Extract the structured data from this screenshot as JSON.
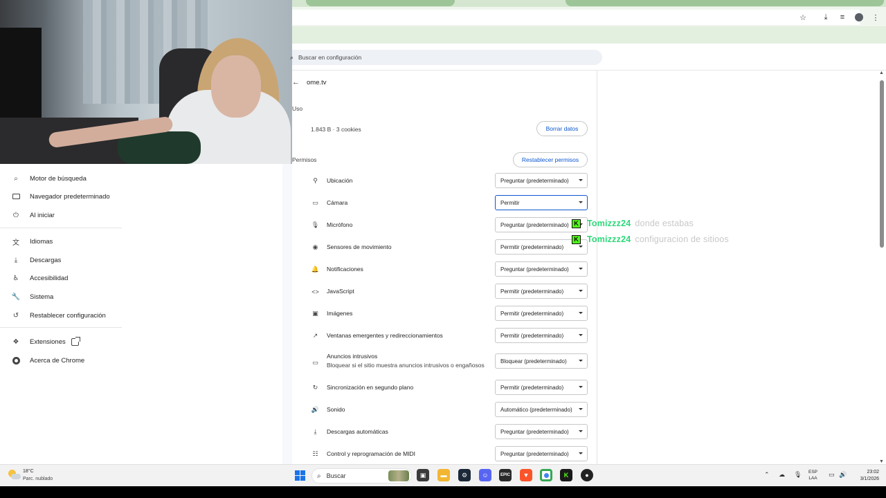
{
  "left_nav": {
    "items": [
      {
        "label": "Motor de búsqueda",
        "icon": "search-icon"
      },
      {
        "label": "Navegador predeterminado",
        "icon": "browser-icon"
      },
      {
        "label": "Al iniciar",
        "icon": "power-icon"
      },
      {
        "label": "Idiomas",
        "icon": "translate-icon"
      },
      {
        "label": "Descargas",
        "icon": "download-icon"
      },
      {
        "label": "Accesibilidad",
        "icon": "accessibility-icon"
      },
      {
        "label": "Sistema",
        "icon": "wrench-icon"
      },
      {
        "label": "Restablecer configuración",
        "icon": "reset-icon"
      },
      {
        "label": "Extensiones",
        "icon": "puzzle-icon"
      },
      {
        "label": "Acerca de Chrome",
        "icon": "chrome-icon"
      }
    ]
  },
  "settings_search": {
    "placeholder": "Buscar en configuración"
  },
  "site": {
    "title": "ome.tv",
    "usage_label": "Uso",
    "usage_value": "1.843 B · 3 cookies",
    "clear_button": "Borrar datos",
    "permissions_label": "Permisos",
    "reset_button": "Restablecer permisos"
  },
  "permissions": [
    {
      "label": "Ubicación",
      "value": "Preguntar (predeterminado)",
      "icon": "location-icon"
    },
    {
      "label": "Cámara",
      "value": "Permitir",
      "icon": "camera-icon",
      "active": true
    },
    {
      "label": "Micrófono",
      "value": "Preguntar (predeterminado)",
      "icon": "microphone-icon"
    },
    {
      "label": "Sensores de movimiento",
      "value": "Permitir (predeterminado)",
      "icon": "sensors-icon"
    },
    {
      "label": "Notificaciones",
      "value": "Preguntar (predeterminado)",
      "icon": "bell-icon"
    },
    {
      "label": "JavaScript",
      "value": "Permitir (predeterminado)",
      "icon": "code-icon"
    },
    {
      "label": "Imágenes",
      "value": "Permitir (predeterminado)",
      "icon": "image-icon"
    },
    {
      "label": "Ventanas emergentes y redireccionamientos",
      "value": "Permitir (predeterminado)",
      "icon": "popup-icon"
    },
    {
      "label": "Anuncios intrusivos",
      "sublabel": "Bloquear si el sitio muestra anuncios intrusivos o engañosos",
      "value": "Bloquear (predeterminado)",
      "icon": "ads-icon"
    },
    {
      "label": "Sincronización en segundo plano",
      "value": "Permitir (predeterminado)",
      "icon": "sync-icon"
    },
    {
      "label": "Sonido",
      "value": "Automático (predeterminado)",
      "icon": "speaker-icon"
    },
    {
      "label": "Descargas automáticas",
      "value": "Preguntar (predeterminado)",
      "icon": "download-icon"
    },
    {
      "label": "Control y reprogramación de MIDI",
      "value": "Preguntar (predeterminado)",
      "icon": "midi-icon"
    }
  ],
  "chat": [
    {
      "badge": "K",
      "user": "Tomizzz24",
      "message": "donde estabas"
    },
    {
      "badge": "K",
      "user": "Tomizzz24",
      "message": "configuracion de sitioos"
    }
  ],
  "taskbar": {
    "weather_temp": "18°C",
    "weather_desc": "Parc. nublado",
    "search_label": "Buscar",
    "lang_top": "ESP",
    "lang_bottom": "LAA",
    "time": "23:02",
    "date": "3/1/2026"
  },
  "colors": {
    "accent": "#0b57d0",
    "chat_user": "#2ed87a",
    "kick_badge": "#53fc18",
    "toolbar": "#f0f6ee"
  }
}
